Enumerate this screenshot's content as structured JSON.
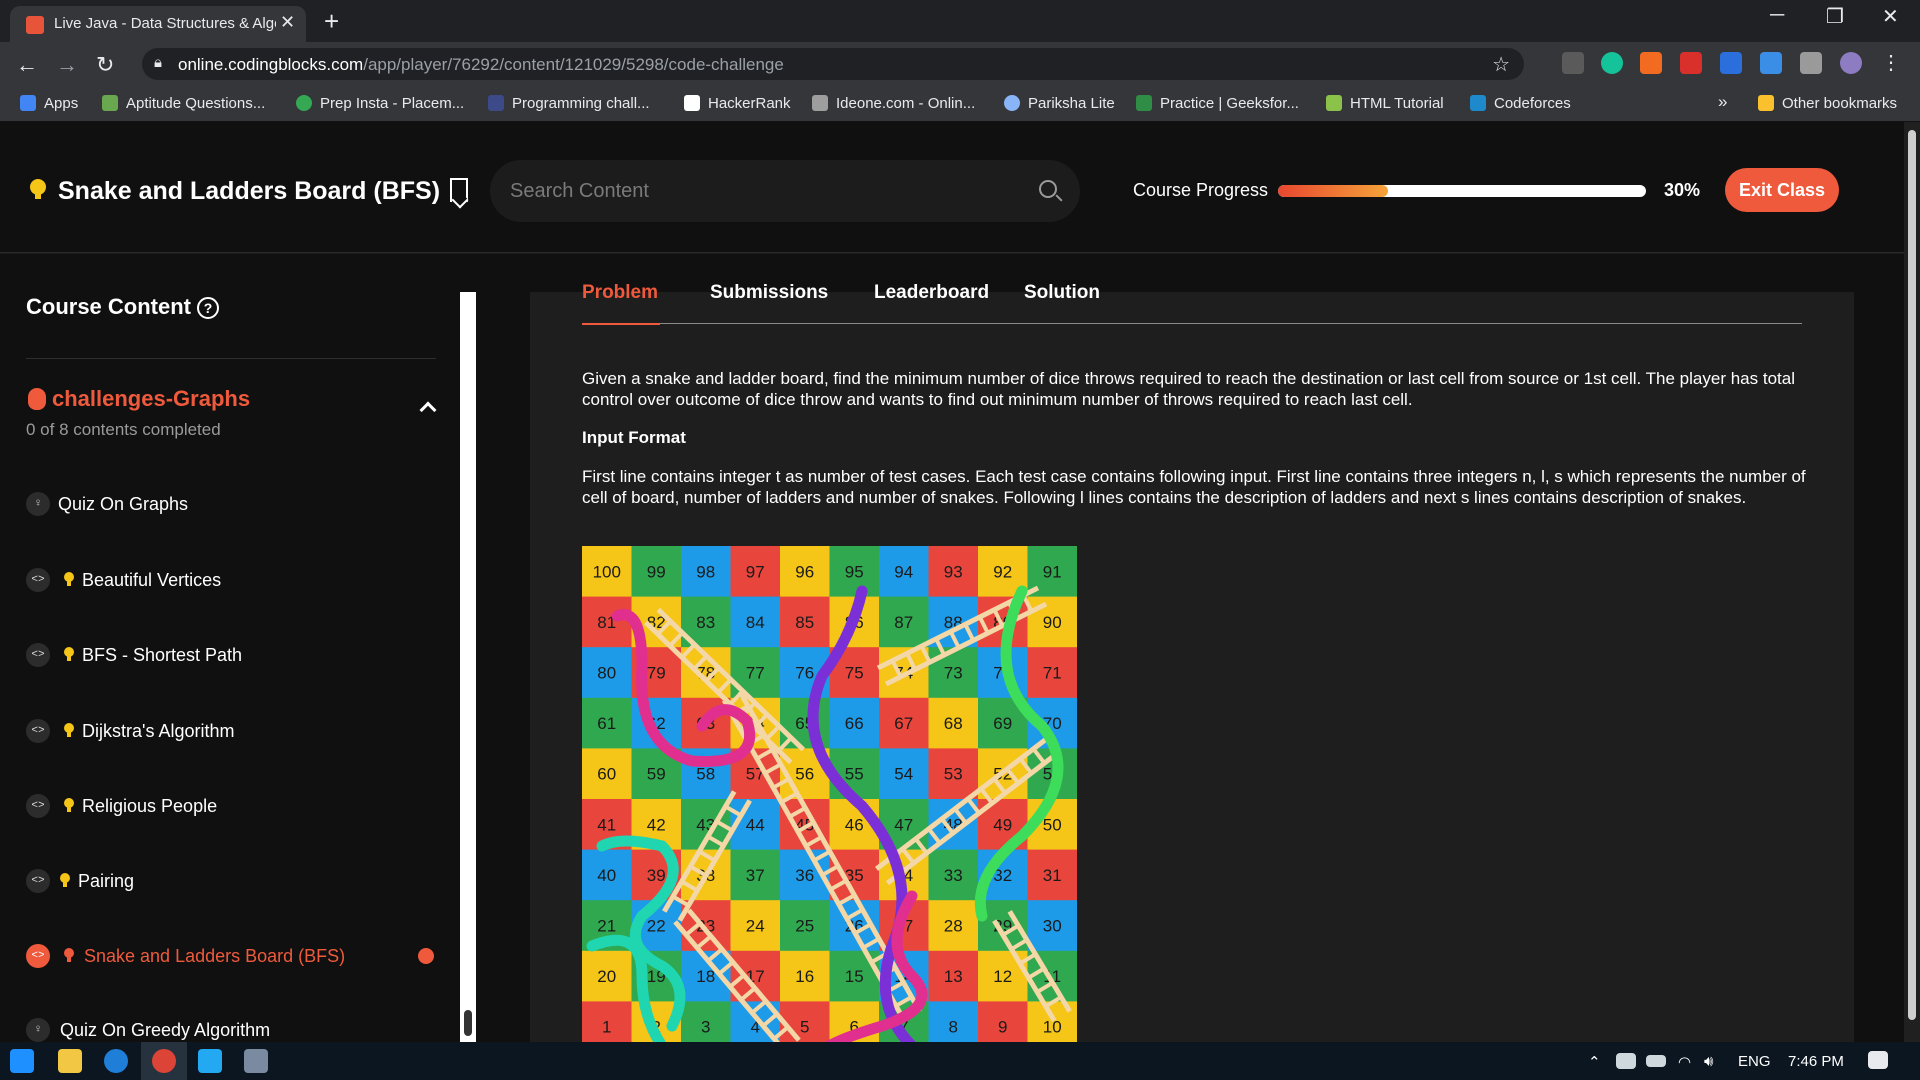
{
  "browser": {
    "tab_title": "Live Java - Data Structures & Algorithms",
    "url_host": "online.codingblocks.com",
    "url_path": "/app/player/76292/content/121029/5298/code-challenge",
    "bookmarks": [
      "Apps",
      "Aptitude Questions...",
      "Prep Insta - Placem...",
      "Programming chall...",
      "HackerRank",
      "Ideone.com - Onlin...",
      "Pariksha Lite",
      "Practice | Geeksfor...",
      "HTML Tutorial",
      "Codeforces"
    ],
    "other_bookmarks": "Other bookmarks",
    "overflow": "»"
  },
  "header": {
    "title": "Snake and Ladders Board (BFS)",
    "search_placeholder": "Search Content",
    "progress_label": "Course Progress",
    "progress_value": 0.3,
    "progress_text": "30%",
    "exit_label": "Exit Class"
  },
  "sidebar": {
    "title": "Course Content",
    "help": "?",
    "section_title": "challenges-Graphs",
    "section_sub": "0 of 8 contents completed",
    "items": [
      {
        "label": "Quiz On Graphs",
        "kind": "quiz"
      },
      {
        "label": "Beautiful Vertices",
        "kind": "code"
      },
      {
        "label": "BFS - Shortest Path",
        "kind": "code"
      },
      {
        "label": "Dijkstra's Algorithm",
        "kind": "code"
      },
      {
        "label": "Religious People",
        "kind": "code"
      },
      {
        "label": "Pairing",
        "kind": "code"
      },
      {
        "label": "Snake and Ladders Board (BFS)",
        "kind": "code",
        "active": true
      },
      {
        "label": "Quiz On Greedy Algorithm",
        "kind": "quiz"
      }
    ]
  },
  "main": {
    "tabs": [
      "Problem",
      "Submissions",
      "Leaderboard",
      "Solution"
    ],
    "description": "Given a snake and ladder board, find the minimum number of dice throws required to reach the destination or last cell from source or 1st cell. The player has total control over outcome of dice throw and wants to find out minimum number of throws required to reach last cell.",
    "input_heading": "Input Format",
    "input_text": "First line contains integer t as number of test cases. Each test case contains following input. First line contains three integers n, l, s which represents the number of cell of board, number of ladders and number of snakes. Following l lines contains the description of ladders and next s lines contains description of snakes."
  },
  "taskbar": {
    "lang": "ENG",
    "time": "7:46 PM"
  },
  "colors": {
    "accent": "#ef5a3c",
    "board": [
      "#f5c518",
      "#e8453c",
      "#1e9be8",
      "#2fa84f"
    ]
  }
}
